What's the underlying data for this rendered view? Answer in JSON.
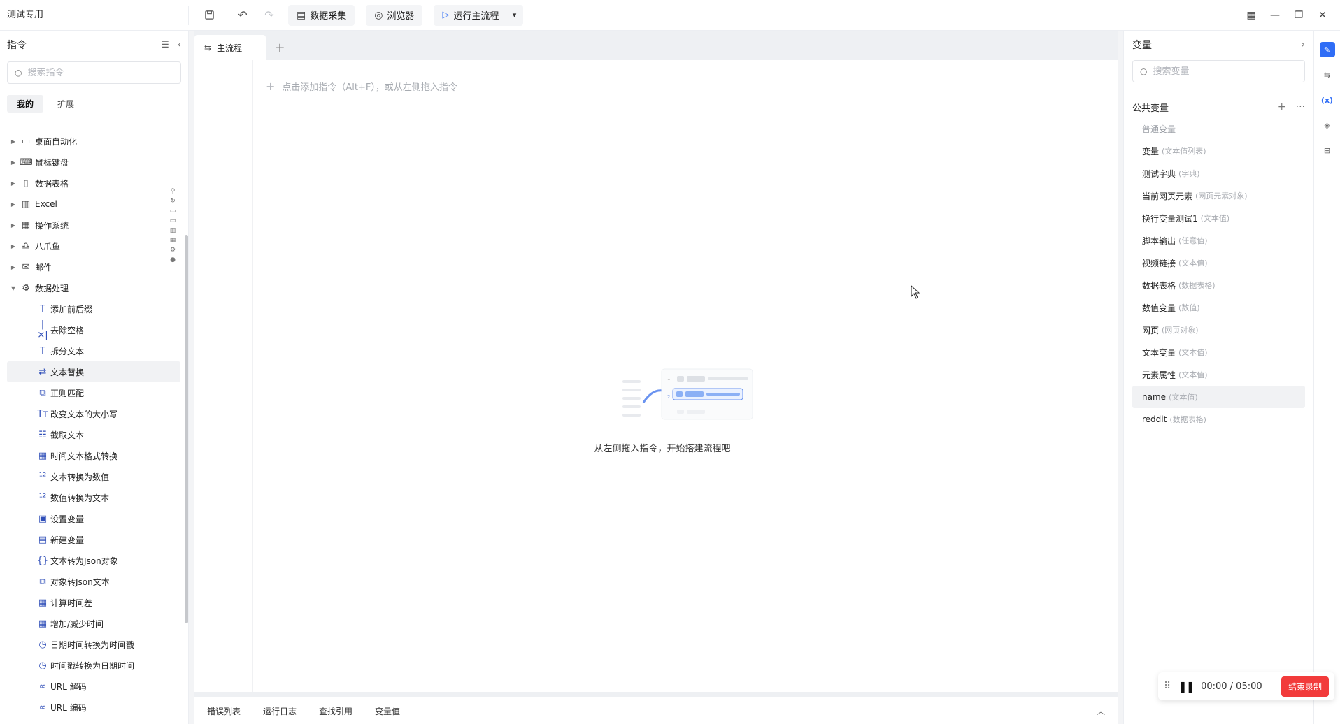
{
  "titlebar": {
    "app_title": "测试专用",
    "data_collect": "数据采集",
    "browser": "浏览器",
    "run_main": "运行主流程"
  },
  "left": {
    "title": "指令",
    "search_placeholder": "搜索指令",
    "tabs": [
      "我的",
      "扩展"
    ],
    "categories": [
      {
        "label": "桌面自动化",
        "icon": "desktop-icon"
      },
      {
        "label": "鼠标键盘",
        "icon": "keyboard-icon"
      },
      {
        "label": "数据表格",
        "icon": "document-icon"
      },
      {
        "label": "Excel",
        "icon": "excel-icon"
      },
      {
        "label": "操作系统",
        "icon": "grid-icon"
      },
      {
        "label": "八爪鱼",
        "icon": "octopus-icon"
      },
      {
        "label": "邮件",
        "icon": "mail-icon"
      },
      {
        "label": "数据处理",
        "icon": "data-process-icon"
      }
    ],
    "children": [
      "添加前后缀",
      "去除空格",
      "拆分文本",
      "文本替换",
      "正则匹配",
      "改变文本的大小写",
      "截取文本",
      "时间文本格式转换",
      "文本转换为数值",
      "数值转换为文本",
      "设置变量",
      "新建变量",
      "文本转为Json对象",
      "对象转Json文本",
      "计算时间差",
      "增加/减少时间",
      "日期时间转换为时间戳",
      "时间戳转换为日期时间",
      "URL 解码",
      "URL 编码"
    ]
  },
  "center": {
    "tab_label": "主流程",
    "hint": "点击添加指令（Alt+F），或从左侧拖入指令",
    "empty_text": "从左侧拖入指令，开始搭建流程吧",
    "bottom_tabs": [
      "错误列表",
      "运行日志",
      "查找引用",
      "变量值"
    ]
  },
  "right": {
    "title": "变量",
    "search_placeholder": "搜索变量",
    "public_vars": "公共变量",
    "group": "普通变量",
    "vars": [
      {
        "name": "变量",
        "type": "(文本值列表)"
      },
      {
        "name": "测试字典",
        "type": "(字典)"
      },
      {
        "name": "当前网页元素",
        "type": "(网页元素对象)"
      },
      {
        "name": "换行变量测试1",
        "type": "(文本值)"
      },
      {
        "name": "脚本输出",
        "type": "(任意值)"
      },
      {
        "name": "视频链接",
        "type": "(文本值)"
      },
      {
        "name": "数据表格",
        "type": "(数据表格)"
      },
      {
        "name": "数值变量",
        "type": "(数值)"
      },
      {
        "name": "网页",
        "type": "(网页对象)"
      },
      {
        "name": "文本变量",
        "type": "(文本值)"
      },
      {
        "name": "元素属性",
        "type": "(文本值)"
      },
      {
        "name": "name",
        "type": "(文本值)"
      },
      {
        "name": "reddit",
        "type": "(数据表格)"
      }
    ]
  },
  "recorder": {
    "time": "00:00 / 05:00",
    "stop_label": "结束录制"
  },
  "colors": {
    "accent": "#2f6df6",
    "stop": "#f23b3b"
  }
}
